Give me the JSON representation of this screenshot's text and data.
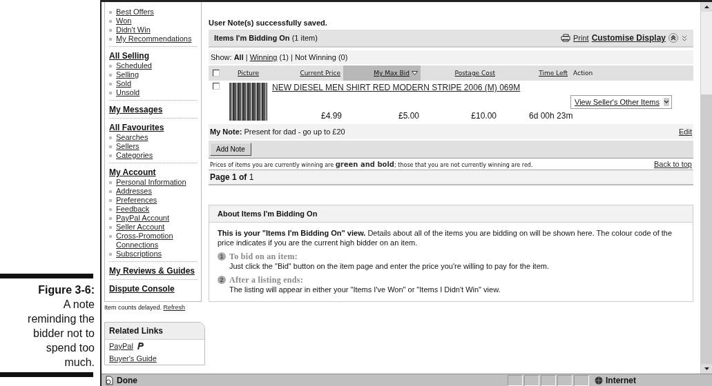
{
  "caption": {
    "label": "Figure 3-6:",
    "text": "A note reminding the bidder not to spend too much."
  },
  "sidebar": {
    "groups": [
      {
        "items": [
          "Best Offers",
          "Won",
          "Didn't Win",
          "My Recommendations"
        ]
      },
      {
        "heading": "All Selling",
        "items": [
          "Scheduled",
          "Selling",
          "Sold",
          "Unsold"
        ]
      },
      {
        "heading": "My Messages"
      },
      {
        "heading": "All Favourites",
        "items": [
          "Searches",
          "Sellers",
          "Categories"
        ]
      },
      {
        "heading": "My Account",
        "items": [
          "Personal Information",
          "Addresses",
          "Preferences",
          "Feedback",
          "PayPal Account",
          "Seller Account",
          "Cross-Promotion Connections",
          "Subscriptions"
        ]
      },
      {
        "heading": "My Reviews & Guides"
      },
      {
        "heading": "Dispute Console"
      }
    ],
    "note": "Item counts delayed.",
    "note_link": "Refresh"
  },
  "related_links": {
    "title": "Related Links",
    "links": [
      {
        "label": "PayPal",
        "icon": true
      },
      {
        "label": "Buyer's Guide",
        "icon": false
      }
    ]
  },
  "message": "User Note(s) successfully saved.",
  "panel": {
    "title": "Items I'm Bidding On",
    "count": "(1 item)",
    "print": "Print",
    "customise": "Customise Display"
  },
  "filter": {
    "label": "Show:",
    "separator": "|",
    "options": [
      {
        "label": "All",
        "selected": true,
        "link": false
      },
      {
        "label": "Winning",
        "count": "(1)",
        "selected": false,
        "link": true
      },
      {
        "label": "Not Winning",
        "count": "(0)",
        "selected": false,
        "link": false
      }
    ]
  },
  "columns": [
    {
      "label": "Picture",
      "link": true,
      "sorted": false
    },
    {
      "label": "Current Price",
      "link": true,
      "sorted": false
    },
    {
      "label": "My Max Bid",
      "link": true,
      "sorted": true
    },
    {
      "label": "Postage Cost",
      "link": true,
      "sorted": false
    },
    {
      "label": "Time Left",
      "link": true,
      "sorted": false
    },
    {
      "label": "Action",
      "link": false,
      "sorted": false
    }
  ],
  "header_checked": false,
  "rows": [
    {
      "checked": false,
      "title": "NEW DIESEL MEN SHIRT RED MODERN STRIPE 2006 (M) 069M",
      "current_price": "£4.99",
      "max_bid": "£5.00",
      "postage": "£10.00",
      "time_left": "6d 00h 23m",
      "action": "View Seller's Other Items",
      "note_label": "My Note:",
      "note": "Present for dad - go up to £20",
      "edit": "Edit"
    }
  ],
  "add_note": "Add Note",
  "legend": "Prices of items you are currently winning are **green and bold**; those that you are not currently winning are red.",
  "back_to_top": "Back to top",
  "pagination": "**Page 1 of** 1",
  "about": {
    "title": "About Items I'm Bidding On",
    "intro": "**This is your \"Items I'm Bidding On\" view.** Details about all of the items you are bidding on will be shown here. The colour code of the price indicates if you are the current high bidder on an item.",
    "steps": [
      {
        "number": "1",
        "title": "To bid on an item:",
        "text": "Just click the \"Bid\" button on the item page and enter the price you're willing to pay for the item."
      },
      {
        "number": "2",
        "title": "After a listing ends:",
        "text": "The listing will appear in either your \"Items I've Won\" or \"Items I Didn't Win\" view."
      }
    ]
  },
  "status_bar": {
    "text": "Done",
    "zone": "Internet"
  }
}
